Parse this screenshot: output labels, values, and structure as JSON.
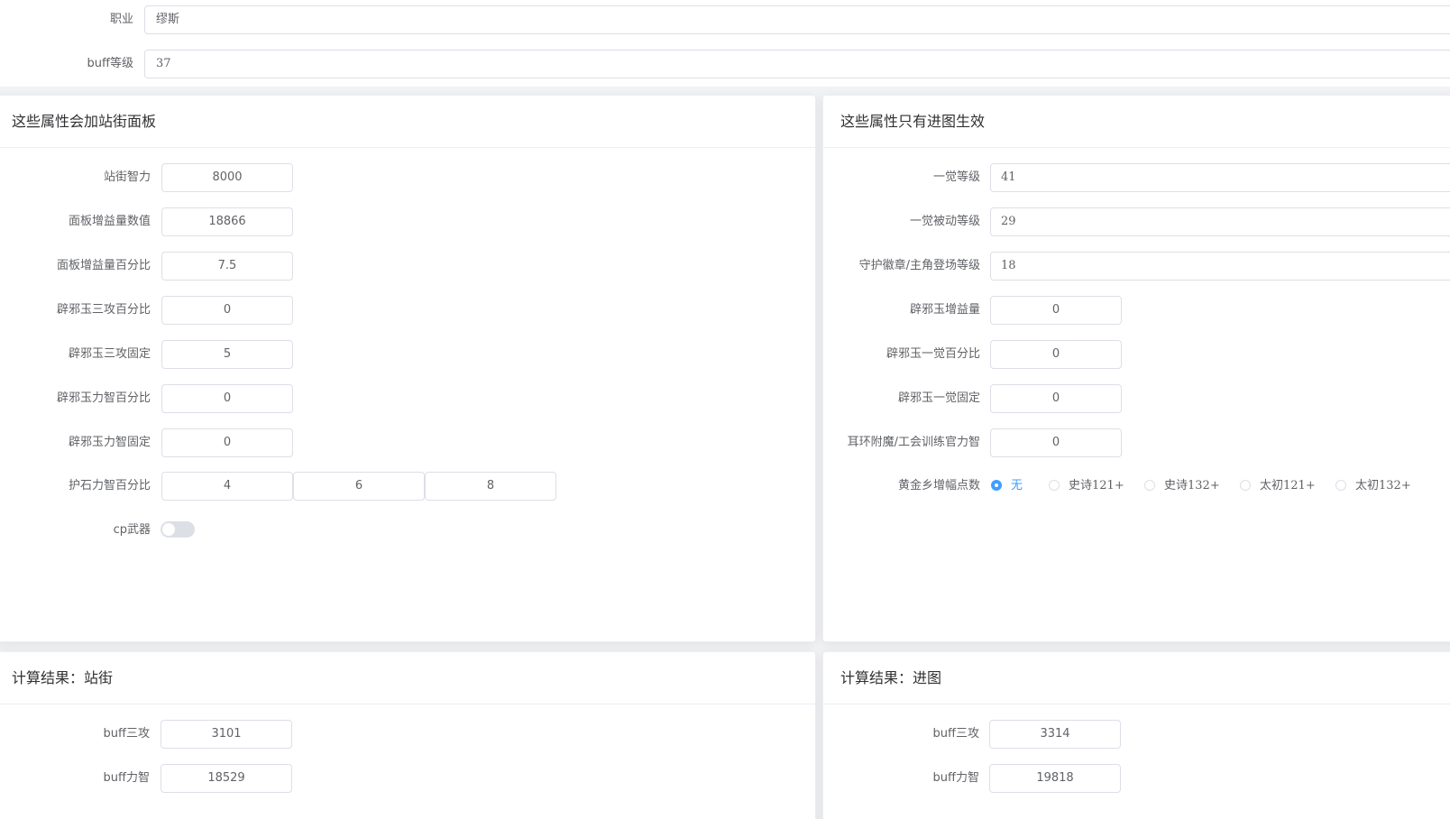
{
  "top": {
    "job_label": "职业",
    "job_value": "缪斯",
    "buff_level_label": "buff等级",
    "buff_level_value": "37"
  },
  "panel_left": {
    "title": "这些属性会加站街面板",
    "fields": [
      {
        "label": "站街智力",
        "value": "8000"
      },
      {
        "label": "面板增益量数值",
        "value": "18866"
      },
      {
        "label": "面板增益量百分比",
        "value": "7.5"
      },
      {
        "label": "辟邪玉三攻百分比",
        "value": "0"
      },
      {
        "label": "辟邪玉三攻固定",
        "value": "5"
      },
      {
        "label": "辟邪玉力智百分比",
        "value": "0"
      },
      {
        "label": "辟邪玉力智固定",
        "value": "0"
      }
    ],
    "guard_stone": {
      "label": "护石力智百分比",
      "values": [
        "4",
        "6",
        "8"
      ]
    },
    "cp_weapon": {
      "label": "cp武器",
      "on": false
    }
  },
  "panel_right": {
    "title": "这些属性只有进图生效",
    "wide_fields": [
      {
        "label": "一觉等级",
        "value": "41"
      },
      {
        "label": "一觉被动等级",
        "value": "29"
      },
      {
        "label": "守护徽章/主角登场等级",
        "value": "18"
      }
    ],
    "short_fields": [
      {
        "label": "辟邪玉增益量",
        "value": "0"
      },
      {
        "label": "辟邪玉一觉百分比",
        "value": "0"
      },
      {
        "label": "辟邪玉一觉固定",
        "value": "0"
      },
      {
        "label": "耳环附魔/工会训练官力智",
        "value": "0"
      }
    ],
    "gold_village": {
      "label": "黄金乡增幅点数",
      "options": [
        "无",
        "史诗121+",
        "史诗132+",
        "太初121+",
        "太初132+"
      ],
      "selected": "无"
    }
  },
  "result_left": {
    "title": "计算结果：站街",
    "fields": [
      {
        "label": "buff三攻",
        "value": "3101"
      },
      {
        "label": "buff力智",
        "value": "18529"
      }
    ]
  },
  "result_right": {
    "title": "计算结果：进图",
    "fields": [
      {
        "label": "buff三攻",
        "value": "3314"
      },
      {
        "label": "buff力智",
        "value": "19818"
      }
    ]
  },
  "colors": {
    "accent": "#409eff",
    "border": "#dcdfe6",
    "text": "#606266",
    "title": "#303133",
    "background": "#f2f3f5"
  }
}
